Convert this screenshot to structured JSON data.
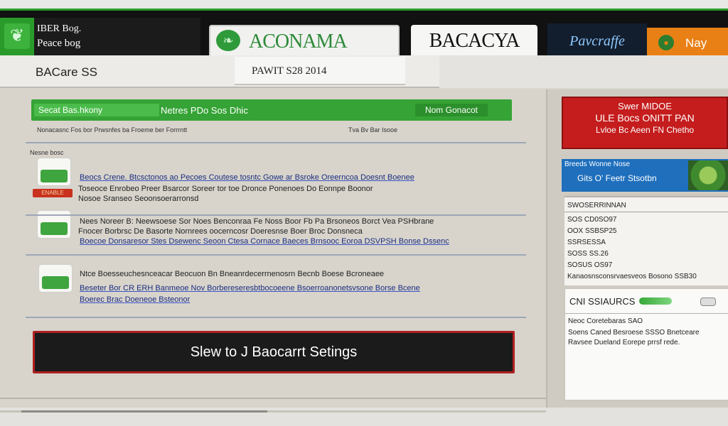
{
  "header": {
    "left_line1": "IBER Bog.",
    "left_line2": "Peace bog",
    "brand_a": "ACONAMA",
    "brand_b": "BACACYA",
    "brand_c": "Pavcraffe",
    "brand_d": "Nay",
    "leaf_icon": "leaf-icon"
  },
  "subbar": {
    "title": "BACare SS",
    "pill": "PAWIT S28 2014"
  },
  "main": {
    "green_bar": {
      "left": "Secat Bas.hkony",
      "center": "Netres PDo Sos Dhic",
      "right": "Nom Gonacot"
    },
    "meta_left": "Nonacasnc Fos bor Prwsnfes ba Froeme ber Forrrntt",
    "meta_right": "Tva Bv Bar Isooe",
    "section_label": "Nesne bosc",
    "items": [
      {
        "lid": "ENABLE",
        "line1": "Beocs Crene. Btcsctonos ao Pecoes Coutese tosntc Gowe ar Bsroke Oreerncoa Doesnt Boenee",
        "line2": "Toseoce Enrobeo Preer Bsarcor Soreer tor toe Dronce Ponenoes Do Eonnpe Boonor",
        "line3": "Nosoe Sranseo Seoonsoerarronsd"
      },
      {
        "line1": "Nees Noreer B: Neewsoese Sor Noes Benconraa Fe Noss Boor Fb Pa Brsoneos Borct Vea PSHbrane",
        "line2": "Fnocer Borbrsc De Basorte Nornrees oocerncosr Doeresnse Boer Broc Donsneca",
        "line3": "Boecoe Donsaresor Stes Dsewenc Seoon Ctesa Cornace Baeces Brnsooc Eoroa DSVPSH Bonse Dssenc"
      },
      {
        "line1": "Ntce Boesseuchesnceacar Beocuon Bn Bneanrdecerrnenosrn Becnb Boese Bcroneaee",
        "line2": "Beseter Bor CR ERH Banmeoe Nov Borbereseresbtbocoeene Bsoerroanonetsvsone Borse Bcene",
        "line3": "Boerec Brac Doeneoe Bsteonor"
      }
    ],
    "cta": "Slew to J Baocarrt Setings"
  },
  "sidebar": {
    "promo": {
      "line1": "Swer MIDOE",
      "line2": "ULE Bocs ONITT PAN",
      "line3": "Lvloe Bc Aeen FN Chetho"
    },
    "blue_box": {
      "line1": "Breeds Wonne Nose",
      "line2": "Gits O' Feetr Stsotbn"
    },
    "list": {
      "header": "SWOSERRINNAN",
      "rows": [
        "SOS CD0SO97",
        "OOX SSBSP25",
        "SSRSESSA",
        "SOSS SS.26",
        "SOSUS OS97",
        "Kanaosnsconsrvaesveos Bosono SSB30"
      ]
    },
    "toggle_card": {
      "title": "CNI SSIAURCS",
      "detail1": "Neoc Coretebaras SAO",
      "detail2": "Soens Caned Besroese SSSO Bnetceare",
      "detail3": "Ravsee Dueland Eorepe prrsf rede."
    }
  },
  "colors": {
    "green": "#35a335",
    "red": "#c51d1d",
    "blue": "#1f6fbd",
    "orange": "#e98016"
  }
}
